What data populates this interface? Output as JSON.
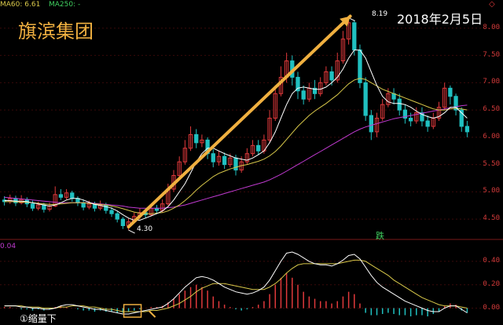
{
  "indicator_bar": {
    "ma60": "MA60: 6.61",
    "ma250": "MA250: -"
  },
  "title": "旗滨集团",
  "date_annotation": "2018年2月5日",
  "high_label": "8.19",
  "low_label": "4.30",
  "drop_label": "跌",
  "macd_value": "0.04",
  "bottom_text": "①缩量下",
  "colors": {
    "up": "#e0393b",
    "down": "#20c0c0",
    "ma_white": "#ffffff",
    "ma_yellow": "#d8c84a",
    "ma_purple": "#c03ad0",
    "arrow": "#f0b040",
    "grid": "#3a0a0a"
  },
  "chart_data": [
    {
      "type": "candlestick",
      "title": "",
      "y_ticks": [
        "8.00",
        "7.50",
        "7.00",
        "6.50",
        "6.00",
        "5.50",
        "5.00",
        "4.50"
      ],
      "ylim": [
        4.2,
        8.3
      ],
      "annotations": [
        {
          "text": "8.19",
          "value": 8.19
        },
        {
          "text": "4.30",
          "value": 4.3
        }
      ],
      "candles": [
        [
          4.85,
          4.82,
          4.92,
          4.75
        ],
        [
          4.82,
          4.88,
          4.95,
          4.78
        ],
        [
          4.88,
          4.8,
          4.93,
          4.74
        ],
        [
          4.8,
          4.86,
          4.94,
          4.77
        ],
        [
          4.86,
          4.78,
          4.9,
          4.72
        ],
        [
          4.78,
          4.7,
          4.84,
          4.65
        ],
        [
          4.7,
          4.76,
          4.82,
          4.66
        ],
        [
          4.76,
          4.68,
          4.8,
          4.62
        ],
        [
          4.68,
          4.74,
          4.8,
          4.64
        ],
        [
          4.74,
          4.95,
          5.1,
          4.72
        ],
        [
          4.95,
          4.9,
          5.05,
          4.85
        ],
        [
          4.9,
          4.98,
          5.05,
          4.86
        ],
        [
          4.98,
          4.88,
          5.02,
          4.82
        ],
        [
          4.88,
          4.8,
          4.92,
          4.74
        ],
        [
          4.8,
          4.72,
          4.86,
          4.66
        ],
        [
          4.72,
          4.78,
          4.84,
          4.68
        ],
        [
          4.78,
          4.7,
          4.82,
          4.64
        ],
        [
          4.7,
          4.76,
          4.84,
          4.66
        ],
        [
          4.76,
          4.66,
          4.8,
          4.6
        ],
        [
          4.66,
          4.6,
          4.72,
          4.54
        ],
        [
          4.6,
          4.5,
          4.64,
          4.44
        ],
        [
          4.5,
          4.38,
          4.54,
          4.32
        ],
        [
          4.38,
          4.45,
          4.52,
          4.3
        ],
        [
          4.45,
          4.55,
          4.62,
          4.42
        ],
        [
          4.55,
          4.62,
          4.7,
          4.5
        ],
        [
          4.62,
          4.58,
          4.68,
          4.52
        ],
        [
          4.58,
          4.7,
          4.78,
          4.55
        ],
        [
          4.7,
          4.66,
          4.76,
          4.6
        ],
        [
          4.66,
          4.78,
          4.86,
          4.62
        ],
        [
          4.78,
          5.05,
          5.15,
          4.75
        ],
        [
          5.05,
          5.3,
          5.4,
          5.0
        ],
        [
          5.3,
          5.55,
          5.65,
          5.25
        ],
        [
          5.55,
          5.8,
          5.95,
          5.5
        ],
        [
          5.8,
          6.05,
          6.2,
          5.75
        ],
        [
          6.05,
          5.9,
          6.15,
          5.8
        ],
        [
          5.9,
          5.95,
          6.05,
          5.82
        ],
        [
          5.95,
          5.7,
          6.0,
          5.6
        ],
        [
          5.7,
          5.55,
          5.78,
          5.45
        ],
        [
          5.55,
          5.65,
          5.75,
          5.48
        ],
        [
          5.65,
          5.5,
          5.72,
          5.42
        ],
        [
          5.5,
          5.62,
          5.7,
          5.45
        ],
        [
          5.62,
          5.4,
          5.68,
          5.3
        ],
        [
          5.4,
          5.55,
          5.65,
          5.35
        ],
        [
          5.55,
          5.7,
          5.8,
          5.5
        ],
        [
          5.7,
          5.85,
          5.95,
          5.65
        ],
        [
          5.85,
          5.75,
          5.95,
          5.68
        ],
        [
          5.75,
          5.95,
          6.05,
          5.7
        ],
        [
          5.95,
          6.35,
          6.5,
          5.9
        ],
        [
          6.35,
          6.8,
          6.95,
          6.3
        ],
        [
          6.8,
          7.1,
          7.3,
          6.75
        ],
        [
          7.1,
          7.4,
          7.55,
          7.0
        ],
        [
          7.4,
          7.1,
          7.5,
          6.95
        ],
        [
          7.1,
          6.85,
          7.2,
          6.7
        ],
        [
          6.85,
          6.7,
          6.95,
          6.6
        ],
        [
          6.7,
          6.9,
          7.0,
          6.65
        ],
        [
          6.9,
          6.8,
          7.05,
          6.7
        ],
        [
          6.8,
          7.0,
          7.1,
          6.75
        ],
        [
          7.0,
          7.2,
          7.3,
          6.95
        ],
        [
          7.2,
          7.05,
          7.3,
          6.95
        ],
        [
          7.05,
          7.4,
          7.55,
          7.0
        ],
        [
          7.4,
          7.8,
          7.95,
          7.35
        ],
        [
          7.8,
          8.1,
          8.19,
          7.7
        ],
        [
          8.1,
          7.6,
          8.15,
          7.5
        ],
        [
          7.6,
          7.0,
          7.7,
          6.9
        ],
        [
          7.0,
          6.4,
          7.1,
          6.3
        ],
        [
          6.4,
          6.1,
          6.5,
          5.95
        ],
        [
          6.1,
          6.35,
          6.45,
          6.0
        ],
        [
          6.35,
          6.6,
          6.7,
          6.3
        ],
        [
          6.6,
          6.8,
          6.9,
          6.55
        ],
        [
          6.8,
          6.7,
          6.9,
          6.6
        ],
        [
          6.7,
          6.5,
          6.8,
          6.4
        ],
        [
          6.5,
          6.35,
          6.6,
          6.25
        ],
        [
          6.35,
          6.3,
          6.45,
          6.2
        ],
        [
          6.3,
          6.45,
          6.55,
          6.25
        ],
        [
          6.45,
          6.3,
          6.55,
          6.2
        ],
        [
          6.3,
          6.2,
          6.4,
          6.1
        ],
        [
          6.2,
          6.35,
          6.45,
          6.15
        ],
        [
          6.35,
          6.55,
          6.65,
          6.3
        ],
        [
          6.55,
          6.9,
          7.0,
          6.5
        ],
        [
          6.9,
          6.75,
          6.95,
          6.6
        ],
        [
          6.75,
          6.5,
          6.8,
          6.4
        ],
        [
          6.5,
          6.2,
          6.55,
          6.1
        ],
        [
          6.2,
          6.1,
          6.3,
          6.0
        ]
      ],
      "ma_white": [
        4.84,
        4.84,
        4.83,
        4.83,
        4.82,
        4.8,
        4.78,
        4.76,
        4.74,
        4.76,
        4.8,
        4.85,
        4.88,
        4.88,
        4.85,
        4.81,
        4.77,
        4.75,
        4.73,
        4.7,
        4.65,
        4.58,
        4.52,
        4.48,
        4.48,
        4.52,
        4.56,
        4.6,
        4.65,
        4.73,
        4.85,
        5.0,
        5.15,
        5.35,
        5.55,
        5.7,
        5.8,
        5.8,
        5.75,
        5.7,
        5.66,
        5.62,
        5.6,
        5.58,
        5.62,
        5.68,
        5.75,
        5.9,
        6.1,
        6.35,
        6.6,
        6.8,
        6.9,
        6.92,
        6.9,
        6.88,
        6.88,
        6.92,
        7.0,
        7.1,
        7.25,
        7.45,
        7.6,
        7.6,
        7.45,
        7.2,
        6.95,
        6.75,
        6.65,
        6.62,
        6.62,
        6.6,
        6.55,
        6.48,
        6.42,
        6.38,
        6.35,
        6.38,
        6.45,
        6.55,
        6.55,
        6.45,
        6.35
      ],
      "ma_yellow": [
        4.82,
        4.82,
        4.82,
        4.81,
        4.81,
        4.8,
        4.79,
        4.78,
        4.77,
        4.77,
        4.78,
        4.79,
        4.8,
        4.8,
        4.8,
        4.79,
        4.78,
        4.77,
        4.76,
        4.74,
        4.72,
        4.69,
        4.66,
        4.63,
        4.61,
        4.6,
        4.6,
        4.61,
        4.62,
        4.65,
        4.7,
        4.76,
        4.84,
        4.93,
        5.03,
        5.12,
        5.2,
        5.28,
        5.34,
        5.38,
        5.42,
        5.45,
        5.48,
        5.5,
        5.53,
        5.56,
        5.6,
        5.66,
        5.74,
        5.84,
        5.96,
        6.08,
        6.2,
        6.3,
        6.4,
        6.48,
        6.55,
        6.62,
        6.7,
        6.78,
        6.88,
        6.98,
        7.05,
        7.08,
        7.06,
        7.0,
        6.94,
        6.88,
        6.84,
        6.8,
        6.76,
        6.72,
        6.68,
        6.64,
        6.6,
        6.56,
        6.52,
        6.5,
        6.5,
        6.52,
        6.53,
        6.52,
        6.5
      ],
      "ma_purple": [
        4.9,
        4.89,
        4.88,
        4.87,
        4.86,
        4.85,
        4.84,
        4.83,
        4.82,
        4.81,
        4.8,
        4.8,
        4.8,
        4.8,
        4.8,
        4.8,
        4.79,
        4.78,
        4.77,
        4.76,
        4.75,
        4.74,
        4.72,
        4.71,
        4.7,
        4.7,
        4.7,
        4.7,
        4.7,
        4.71,
        4.72,
        4.74,
        4.76,
        4.79,
        4.82,
        4.85,
        4.88,
        4.91,
        4.94,
        4.97,
        5.0,
        5.03,
        5.06,
        5.09,
        5.12,
        5.15,
        5.18,
        5.22,
        5.27,
        5.32,
        5.38,
        5.44,
        5.5,
        5.56,
        5.62,
        5.68,
        5.74,
        5.8,
        5.86,
        5.92,
        5.98,
        6.04,
        6.1,
        6.15,
        6.19,
        6.22,
        6.25,
        6.28,
        6.31,
        6.34,
        6.36,
        6.38,
        6.4,
        6.42,
        6.44,
        6.46,
        6.48,
        6.5,
        6.52,
        6.54,
        6.56,
        6.58,
        6.59
      ]
    },
    {
      "type": "macd",
      "title": "",
      "y_ticks": [
        "0.40",
        "0.20",
        "0.00"
      ],
      "ylim": [
        -0.05,
        0.5
      ],
      "histogram": [
        0.01,
        0.01,
        0.0,
        -0.01,
        -0.01,
        -0.02,
        -0.01,
        -0.02,
        -0.01,
        0.01,
        0.02,
        0.01,
        0.0,
        -0.01,
        -0.02,
        -0.02,
        -0.03,
        -0.02,
        -0.03,
        -0.03,
        -0.04,
        -0.04,
        -0.03,
        -0.02,
        -0.01,
        0.0,
        0.01,
        0.01,
        0.02,
        0.05,
        0.08,
        0.12,
        0.15,
        0.18,
        0.2,
        0.18,
        0.15,
        0.1,
        0.06,
        0.03,
        0.01,
        -0.01,
        -0.02,
        -0.01,
        0.01,
        0.03,
        0.06,
        0.12,
        0.2,
        0.26,
        0.3,
        0.26,
        0.2,
        0.14,
        0.1,
        0.08,
        0.06,
        0.06,
        0.04,
        0.06,
        0.1,
        0.14,
        0.12,
        0.04,
        -0.04,
        -0.06,
        -0.06,
        -0.05,
        -0.04,
        -0.05,
        -0.06,
        -0.06,
        -0.07,
        -0.06,
        -0.06,
        -0.07,
        -0.05,
        -0.03,
        0.02,
        0.04,
        0.03,
        -0.02,
        -0.04
      ],
      "dif": [
        0.02,
        0.02,
        0.02,
        0.01,
        0.01,
        0.0,
        0.0,
        -0.01,
        -0.01,
        0.0,
        0.02,
        0.03,
        0.03,
        0.02,
        0.01,
        0.0,
        -0.01,
        -0.01,
        -0.02,
        -0.03,
        -0.04,
        -0.05,
        -0.05,
        -0.04,
        -0.03,
        -0.02,
        -0.01,
        0.0,
        0.01,
        0.04,
        0.08,
        0.13,
        0.18,
        0.22,
        0.26,
        0.27,
        0.26,
        0.24,
        0.21,
        0.18,
        0.16,
        0.14,
        0.13,
        0.12,
        0.13,
        0.15,
        0.18,
        0.24,
        0.32,
        0.4,
        0.47,
        0.48,
        0.46,
        0.43,
        0.4,
        0.38,
        0.37,
        0.37,
        0.36,
        0.38,
        0.41,
        0.45,
        0.46,
        0.42,
        0.35,
        0.28,
        0.22,
        0.18,
        0.15,
        0.12,
        0.09,
        0.06,
        0.04,
        0.02,
        0.0,
        -0.02,
        -0.03,
        -0.03,
        0.0,
        0.02,
        0.02,
        -0.01,
        -0.04
      ],
      "dea": [
        0.02,
        0.02,
        0.02,
        0.02,
        0.01,
        0.01,
        0.01,
        0.0,
        0.0,
        0.0,
        0.01,
        0.01,
        0.02,
        0.02,
        0.02,
        0.01,
        0.01,
        0.0,
        -0.01,
        -0.01,
        -0.02,
        -0.03,
        -0.03,
        -0.03,
        -0.03,
        -0.03,
        -0.02,
        -0.02,
        -0.01,
        0.0,
        0.02,
        0.04,
        0.07,
        0.1,
        0.14,
        0.17,
        0.19,
        0.21,
        0.21,
        0.21,
        0.2,
        0.19,
        0.18,
        0.17,
        0.16,
        0.16,
        0.16,
        0.18,
        0.21,
        0.25,
        0.3,
        0.34,
        0.37,
        0.38,
        0.38,
        0.38,
        0.38,
        0.38,
        0.38,
        0.38,
        0.39,
        0.4,
        0.41,
        0.41,
        0.4,
        0.37,
        0.34,
        0.31,
        0.28,
        0.24,
        0.21,
        0.18,
        0.15,
        0.12,
        0.09,
        0.07,
        0.05,
        0.03,
        0.02,
        0.02,
        0.02,
        0.01,
        0.0
      ]
    }
  ]
}
